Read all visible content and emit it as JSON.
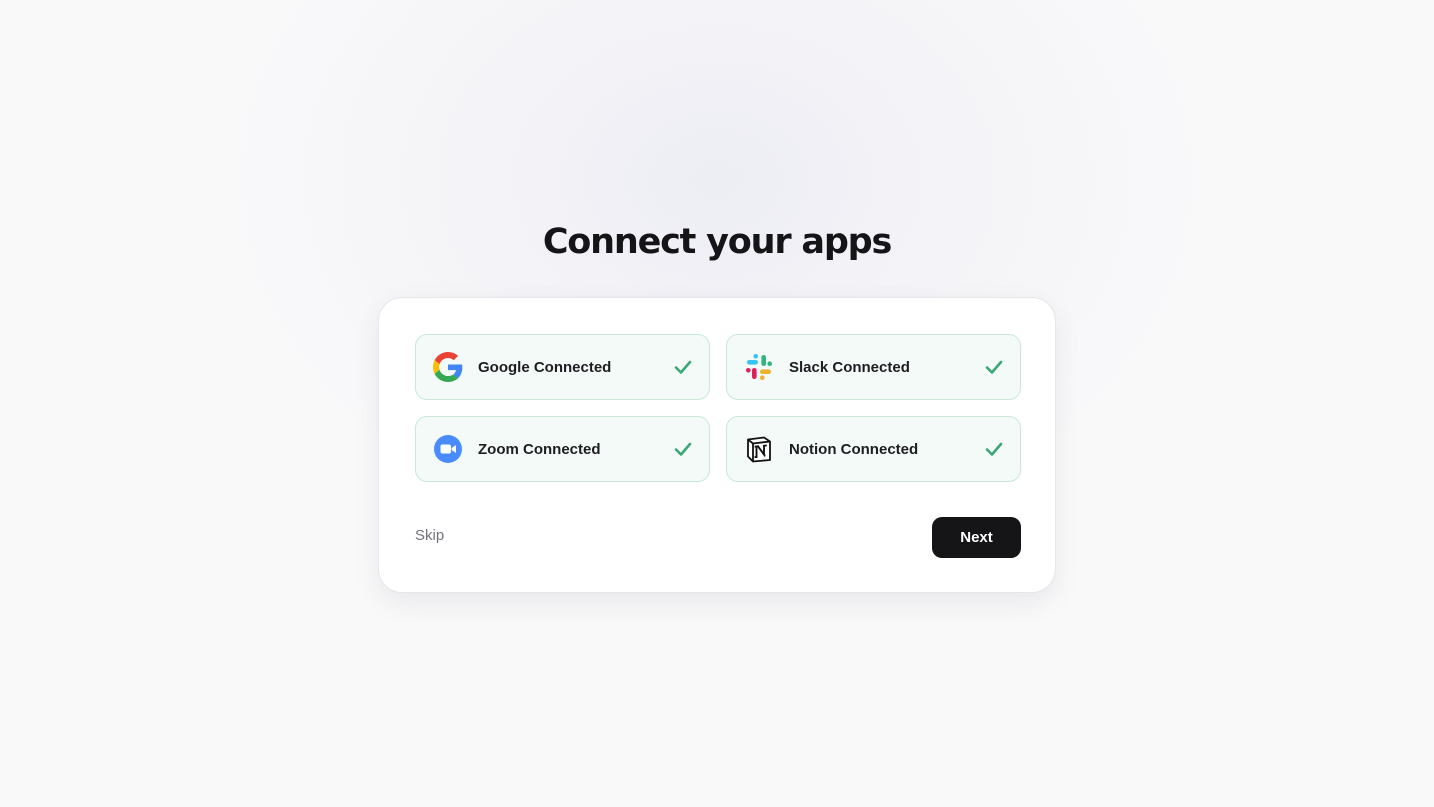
{
  "page": {
    "title": "Connect your apps"
  },
  "apps": [
    {
      "name": "Google",
      "label": "Google Connected",
      "icon": "google-icon",
      "status": "connected"
    },
    {
      "name": "Slack",
      "label": "Slack Connected",
      "icon": "slack-icon",
      "status": "connected"
    },
    {
      "name": "Zoom",
      "label": "Zoom Connected",
      "icon": "zoom-icon",
      "status": "connected"
    },
    {
      "name": "Notion",
      "label": "Notion Connected",
      "icon": "notion-icon",
      "status": "connected"
    }
  ],
  "actions": {
    "skip_label": "Skip",
    "next_label": "Next"
  },
  "colors": {
    "accent": "#151517",
    "connected_bg": "#f4faf7",
    "connected_border": "#c9e8d8",
    "check": "#3aa876"
  }
}
